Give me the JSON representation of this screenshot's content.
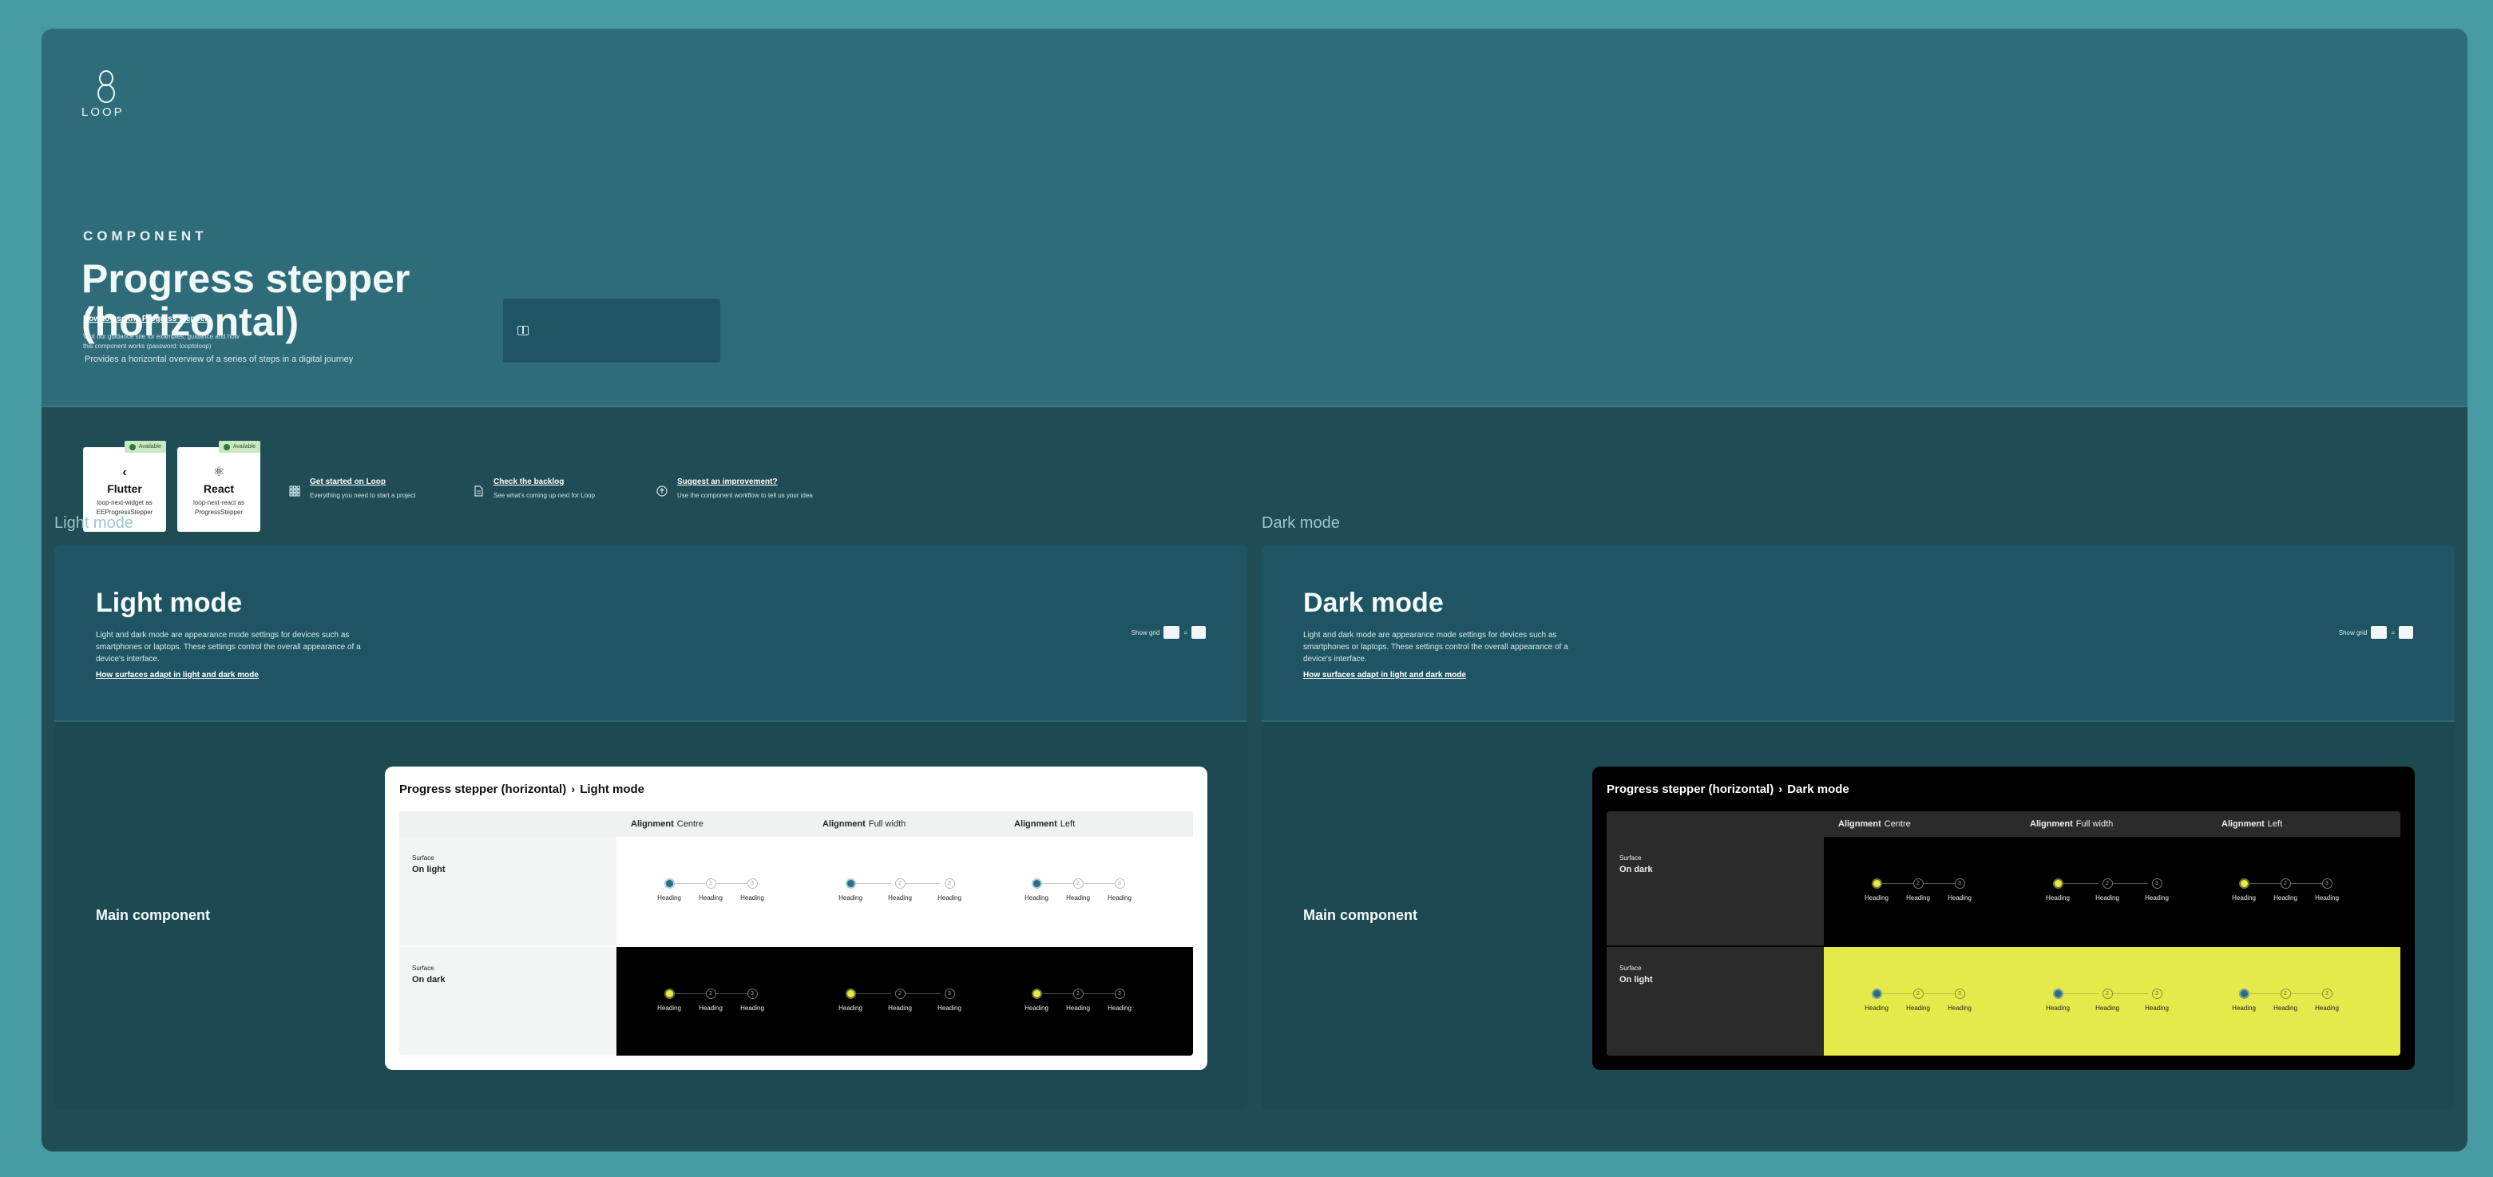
{
  "brand": {
    "logo_text": "LOOP"
  },
  "header": {
    "eyebrow": "COMPONENT",
    "title": "Progress stepper (horizontal)",
    "subtitle": "Provides a horizontal overview of a series of steps in a digital journey"
  },
  "guide": {
    "link": "How to use the Progress stepper",
    "description": "Visit our guidance site for examples, guidance and how this component works (password: looptoloop)"
  },
  "platforms": [
    {
      "badge": "Available",
      "icon": "flutter-icon",
      "name": "Flutter",
      "package": "loop-next-widget as EEProgressStepper"
    },
    {
      "badge": "Available",
      "icon": "react-icon",
      "name": "React",
      "package": "loop-next-react as ProgressStepper"
    }
  ],
  "quick_links": [
    {
      "icon": "grid-icon",
      "title": "Get started on Loop",
      "desc": "Everything you need to start a project"
    },
    {
      "icon": "document-icon",
      "title": "Check the backlog",
      "desc": "See what's coming up next for Loop"
    },
    {
      "icon": "arrow-up-circle-icon",
      "title": "Suggest an improvement?",
      "desc": "Use the component workflow to tell us your idea"
    }
  ],
  "light": {
    "section_label": "Light mode",
    "heading": "Light mode",
    "description": "Light and dark mode are appearance mode settings for devices such as smartphones or laptops. These settings control the overall appearance of a device's interface.",
    "link": "How surfaces adapt in light and dark mode",
    "show_grid": "Show grid",
    "main_component": "Main component",
    "demo_title": "Progress stepper (horizontal)",
    "demo_mode": "Light mode",
    "rows": [
      {
        "key": "Surface",
        "value": "On light"
      },
      {
        "key": "Surface",
        "value": "On dark"
      }
    ]
  },
  "dark": {
    "section_label": "Dark mode",
    "heading": "Dark mode",
    "description": "Light and dark mode are appearance mode settings for devices such as smartphones or laptops. These settings control the overall appearance of a device's interface.",
    "link": "How surfaces adapt in light and dark mode",
    "show_grid": "Show grid",
    "main_component": "Main component",
    "demo_title": "Progress stepper (horizontal)",
    "demo_mode": "Dark mode",
    "rows": [
      {
        "key": "Surface",
        "value": "On dark"
      },
      {
        "key": "Surface",
        "value": "On light"
      }
    ]
  },
  "columns": [
    {
      "key": "Alignment",
      "value": "Centre"
    },
    {
      "key": "Alignment",
      "value": "Full width"
    },
    {
      "key": "Alignment",
      "value": "Left"
    }
  ],
  "step_labels": [
    "Heading",
    "Heading",
    "Heading"
  ],
  "step_numbers": [
    "",
    "2",
    "3"
  ],
  "colors": {
    "page_bg": "#479aa2",
    "header_bg": "#2f6c7a",
    "accent_yellow": "#e3ea4a",
    "accent_teal": "#2b6e7e",
    "badge_green": "#c7e8c1"
  }
}
